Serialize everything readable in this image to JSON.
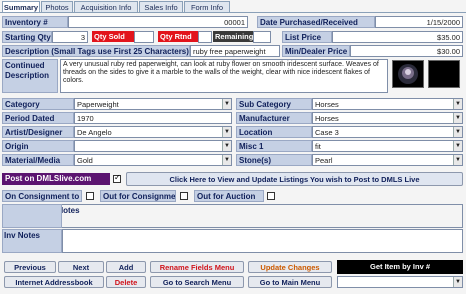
{
  "tabs": [
    "Summary",
    "Photos",
    "Acquisition Info",
    "Sales Info",
    "Form Info"
  ],
  "inventory": {
    "label": "Inventory #",
    "value": "00001"
  },
  "date_purchased": {
    "label": "Date Purchased/Received",
    "value": "1/15/2000"
  },
  "starting_qty": {
    "label": "Starting Qty",
    "value": "3"
  },
  "qty_sold": "Qty Sold",
  "qty_rtnd": "Qty Rtnd",
  "remaining": "Remaining",
  "list_price": {
    "label": "List Price",
    "value": "$35.00"
  },
  "description": {
    "label": "Description (Small Tags use First 25 Characters)",
    "value": "ruby free paperweight"
  },
  "min_dealer_price": {
    "label": "Min/Dealer Price",
    "value": "$30.00"
  },
  "continued_description": {
    "label": "Continued Description",
    "value": "A very unusual ruby red paperweight, can look at ruby flower on smooth iridescent surface. Weaves of threads on the sides to give it a marble to the walls of the weight, clear with nice iridescent flakes of colors."
  },
  "fields_left": [
    {
      "label": "Category",
      "value": "Paperweight"
    },
    {
      "label": "Period Dated",
      "value": "1970"
    },
    {
      "label": "Artist/Designer",
      "value": "De Angelo"
    },
    {
      "label": "Origin",
      "value": ""
    },
    {
      "label": "Material/Media",
      "value": "Gold"
    }
  ],
  "fields_right": [
    {
      "label": "Sub Category",
      "value": "Horses"
    },
    {
      "label": "Manufacturer",
      "value": "Horses"
    },
    {
      "label": "Location",
      "value": "Case 3"
    },
    {
      "label": "Misc 1",
      "value": "fit"
    },
    {
      "label": "Stone(s)",
      "value": "Pearl"
    }
  ],
  "post_dmls": "Post on DMLSlive.com",
  "dmls_button": "Click Here to View and Update Listings You wish to Post to DMLS Live",
  "on_consignment_to_us": "On Consignment to Us",
  "out_for_consignment": "Out for Consignment",
  "out_for_auction": "Out for Auction",
  "consignment_notes": "Consignment Notes",
  "inv_notes": "Inv Notes",
  "buttons_row1": [
    "Previous",
    "Next",
    "Add",
    "Rename Fields Menu",
    "Update Changes"
  ],
  "buttons_row2": [
    "Internet Addressbook",
    "Delete",
    "Go to Search Menu",
    "Go to Main Menu"
  ],
  "get_item": "Get Item by Inv #",
  "colors": {
    "label_bg": "#c5d0e4",
    "accent_red": "#e2141c",
    "purple": "#5b1470"
  }
}
